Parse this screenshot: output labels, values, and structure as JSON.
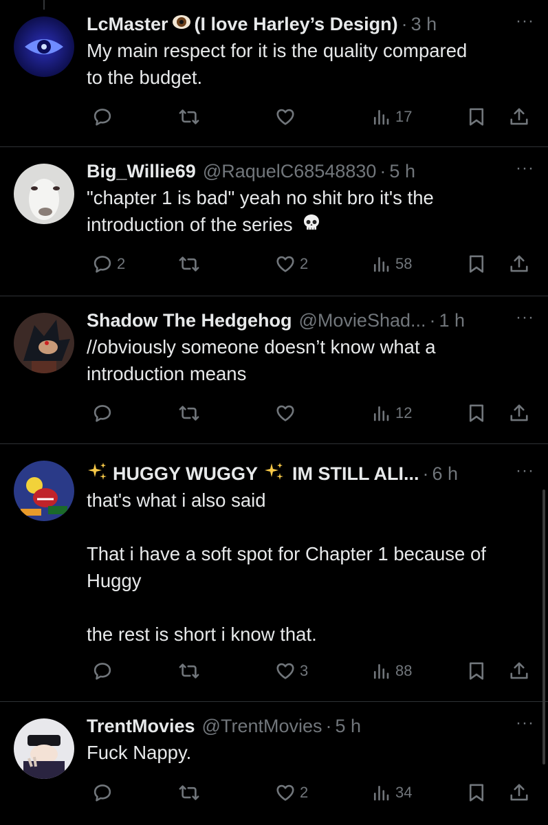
{
  "tweets": [
    {
      "name": "LcMaster",
      "name_suffix": "(I love Harley’s Design)",
      "handle": "",
      "dot": "·",
      "time": "3 h",
      "more": "···",
      "text": "My main respect for it is the quality compared\nto the budget.",
      "replies": "",
      "retweets": "",
      "likes": "",
      "views": "17"
    },
    {
      "name": "Big_Willie69",
      "handle": "@RaquelC68548830",
      "dot": "·",
      "time": "5 h",
      "more": "···",
      "text": "\"chapter 1 is bad\" yeah no shit bro it's the\nintroduction of the series",
      "replies": "2",
      "retweets": "",
      "likes": "2",
      "views": "58"
    },
    {
      "name": "Shadow The Hedgehog",
      "handle": "@MovieShad...",
      "dot": "·",
      "time": "1 h",
      "more": "···",
      "text": "//obviously someone doesn’t know what a\nintroduction means",
      "replies": "",
      "retweets": "",
      "likes": "",
      "views": "12"
    },
    {
      "name": "HUGGY WUGGY",
      "name_suffix": "IM STILL ALI...",
      "handle": "",
      "dot": "·",
      "time": "6 h",
      "more": "···",
      "text": "that's what i also said\n\nThat i have a soft spot for Chapter 1 because of\nHuggy\n\nthe rest is short i know that.",
      "replies": "",
      "retweets": "",
      "likes": "3",
      "views": "88"
    },
    {
      "name": "TrentMovies",
      "handle": "@TrentMovies",
      "dot": "·",
      "time": "5 h",
      "more": "···",
      "text": "Fuck Nappy.",
      "replies": "",
      "retweets": "",
      "likes": "2",
      "views": "34"
    }
  ],
  "icons": {
    "reply": "reply-icon",
    "retweet": "retweet-icon",
    "like": "heart-icon",
    "views": "views-icon",
    "bookmark": "bookmark-icon",
    "share": "share-icon",
    "eye_emoji": "eye-emoji-icon",
    "sparkles": "sparkles-emoji-icon",
    "skull": "skull-emoji-icon"
  },
  "colors": {
    "background": "#000000",
    "primary_text": "#e7e9ea",
    "secondary_text": "#71767b",
    "divider": "#2f3336"
  }
}
